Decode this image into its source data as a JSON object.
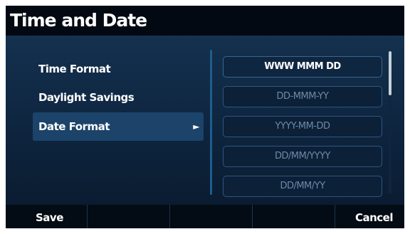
{
  "header": {
    "title": "Time and Date"
  },
  "menu": {
    "items": [
      {
        "label": "Time Format",
        "selected": false
      },
      {
        "label": "Daylight Savings",
        "selected": false
      },
      {
        "label": "Date Format",
        "selected": true
      }
    ],
    "selected_arrow": "►"
  },
  "options": {
    "items": [
      {
        "label": "WWW MMM DD",
        "current": true
      },
      {
        "label": "DD-MMM-YY",
        "current": false
      },
      {
        "label": "YYYY-MM-DD",
        "current": false
      },
      {
        "label": "DD/MM/YYYY",
        "current": false
      },
      {
        "label": "DD/MM/YY",
        "current": false
      }
    ]
  },
  "softkeys": {
    "save": "Save",
    "key2": "",
    "key3": "",
    "key4": "",
    "cancel": "Cancel"
  },
  "colors": {
    "background": "#0b1a2b",
    "title_bar": "#020912",
    "selected_row": "#1c4369",
    "option_border": "#2e5680",
    "text": "#ffffff",
    "dim_text": "#6d8aa8"
  },
  "icons": {
    "submenu_arrow": "play-arrow-icon"
  }
}
